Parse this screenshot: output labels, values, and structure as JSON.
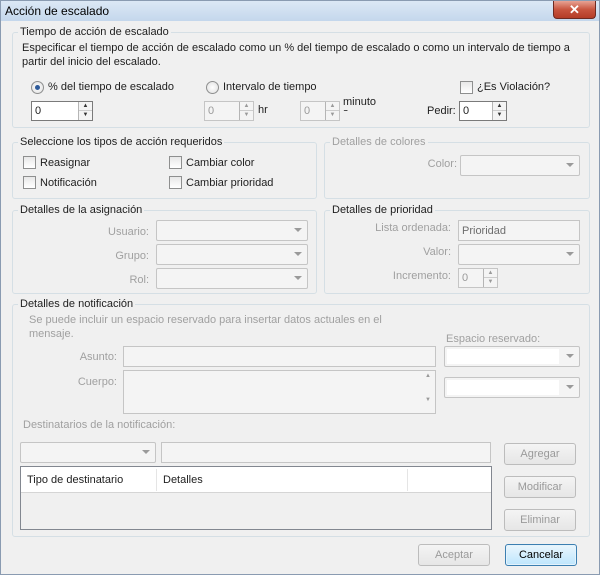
{
  "window": {
    "title": "Acción de escalado",
    "close_glyph": "✕"
  },
  "tiempo": {
    "legend": "Tiempo de acción de escalado",
    "description": "Especificar el tiempo de acción de escalado como un % del tiempo de escalado o como un intervalo de tiempo a partir del inicio del escalado.",
    "pct_radio_label": "% del tiempo de escalado",
    "pct_value": "0",
    "intervalo_radio_label": "Intervalo de tiempo",
    "hr_value": "0",
    "hr_label": "hr",
    "min_value": "0",
    "min_label": "minuto\ns",
    "violacion_label": "¿Es Violación?",
    "pedir_label": "Pedir:",
    "pedir_value": "0"
  },
  "tipos": {
    "legend": "Seleccione los tipos de acción requeridos",
    "reasignar": "Reasignar",
    "cambiar_color": "Cambiar color",
    "notificacion": "Notificación",
    "cambiar_prioridad": "Cambiar prioridad"
  },
  "colores": {
    "legend": "Detalles de colores",
    "color_label": "Color:"
  },
  "asignacion": {
    "legend": "Detalles de la asignación",
    "usuario_label": "Usuario:",
    "grupo_label": "Grupo:",
    "rol_label": "Rol:"
  },
  "prioridad": {
    "legend": "Detalles de prioridad",
    "lista_label": "Lista ordenada:",
    "lista_value": "Prioridad",
    "valor_label": "Valor:",
    "incremento_label": "Incremento:",
    "incremento_value": "0"
  },
  "notificacion": {
    "legend": "Detalles de notificación",
    "hint": "Se puede incluir un espacio reservado para insertar datos actuales en el mensaje.",
    "asunto_label": "Asunto:",
    "cuerpo_label": "Cuerpo:",
    "espacio_label": "Espacio reservado:",
    "destinatarios_label": "Destinatarios de la notificación:",
    "agregar": "Agregar",
    "modificar": "Modificar",
    "eliminar": "Eliminar",
    "columns": [
      "Tipo de destinatario",
      "Detalles"
    ]
  },
  "footer": {
    "aceptar": "Aceptar",
    "cancelar": "Cancelar"
  },
  "colors": {
    "title_bar": "#c4d7ec",
    "close_button": "#c8553f",
    "default_button_border": "#3c7fb1",
    "disabled_text": "#a0a0a0",
    "panel": "#f0f0f0"
  }
}
